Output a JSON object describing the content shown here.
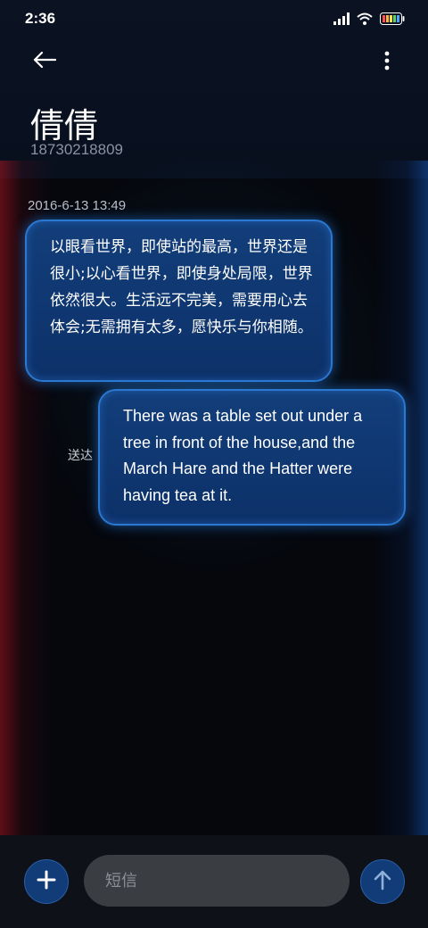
{
  "status_bar": {
    "time": "2:36",
    "icons": [
      "signal-icon",
      "wifi-icon",
      "battery-icon"
    ]
  },
  "header": {
    "back_icon": "arrow-left-icon",
    "more_icon": "more-vertical-icon",
    "contact_name": "倩倩",
    "contact_number": "18730218809"
  },
  "conversation": {
    "timestamp": "2016-6-13 13:49",
    "messages": [
      {
        "direction": "incoming",
        "text": "以眼看世界，即使站的最高，世界还是很小;以心看世界，即使身处局限，世界依然很大。生活远不完美，需要用心去体会;无需拥有太多，愿快乐与你相随。"
      },
      {
        "direction": "outgoing",
        "text": "There was a table set out under a tree in front of the house,and the March Hare and the Hatter were having tea at it.",
        "status": "送达"
      }
    ]
  },
  "composer": {
    "add_icon": "plus-icon",
    "placeholder": "短信",
    "value": "",
    "send_icon": "arrow-up-icon"
  },
  "colors": {
    "bubble": "#0f3670",
    "bubble_border": "#2a78d0",
    "button": "#123c78",
    "background": "#05070d"
  }
}
